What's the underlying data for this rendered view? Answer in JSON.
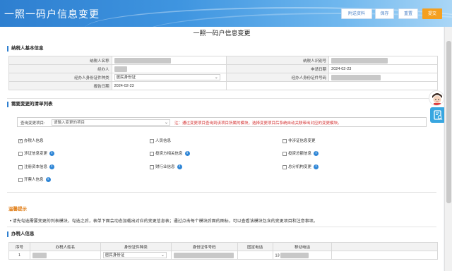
{
  "header": {
    "title": "一照一码户信息变更",
    "buttons": {
      "attach": "附送资料",
      "save": "保存",
      "reset": "重置",
      "submit": "提交"
    }
  },
  "page_title": "一照一码户信息变更",
  "taxpayer_basic": {
    "section_title": "纳税人基本信息",
    "name_label": "纳税人名称",
    "id_label": "纳税人识别号",
    "agent_label": "经办人",
    "apply_date_label": "申请日期",
    "apply_date": "2024-02-23",
    "agent_id_type_label": "经办人身份证件种类",
    "agent_id_type": "居民身份证",
    "agent_id_no_label": "经办人身份证件号码",
    "report_date_label": "报告日期",
    "report_date": "2024-02-23"
  },
  "change_list": {
    "section_title": "需要变更的清单列表",
    "query_label": "查询变更项目:",
    "query_placeholder": "请输入变更的项目",
    "warning": "注：通过变更项目查询到该项目所属的模块，选择变更项目后系统自动关联带出对应的变更模块。",
    "items": [
      {
        "label": "办税人信息",
        "checked": true,
        "info": false
      },
      {
        "label": "人员信息",
        "checked": false,
        "info": false
      },
      {
        "label": "非涉证信息变更",
        "checked": false,
        "info": false
      },
      {
        "label": "涉证信息变更",
        "checked": false,
        "info": true
      },
      {
        "label": "投资方相关信息",
        "checked": false,
        "info": true
      },
      {
        "label": "投资总额信息",
        "checked": false,
        "info": true
      },
      {
        "label": "注册资本信息",
        "checked": false,
        "info": true
      },
      {
        "label": "财行业信息",
        "checked": false,
        "info": true
      },
      {
        "label": "总分机构变更",
        "checked": false,
        "info": true
      },
      {
        "label": "开票人信息",
        "checked": false,
        "info": true
      }
    ]
  },
  "tips": {
    "title": "温馨提示",
    "text": "• 请先勾选需要变更的列表模块，勾选之后，表单下面会动态加载出对应的变更信息表；通过点击每个模块后面的图标，可以查看该模块包含的变更项目和注意事项。"
  },
  "taxpayer_person": {
    "section_title": "办税人信息",
    "columns": [
      "序号",
      "办税人姓名",
      "身份证件种类",
      "身份证件号码",
      "固定电话",
      "移动电话"
    ],
    "row": {
      "index": "1",
      "id_type": "居民身份证",
      "mobile_prefix": "13"
    }
  },
  "icons": {
    "sidebar_button": "document-search-icon",
    "assistant": "assistant-avatar-icon",
    "info": "info-icon"
  },
  "colors": {
    "header": "#2e7fd0",
    "submit": "#f5a020",
    "warning": "#d43030",
    "info": "#2f86d6"
  }
}
